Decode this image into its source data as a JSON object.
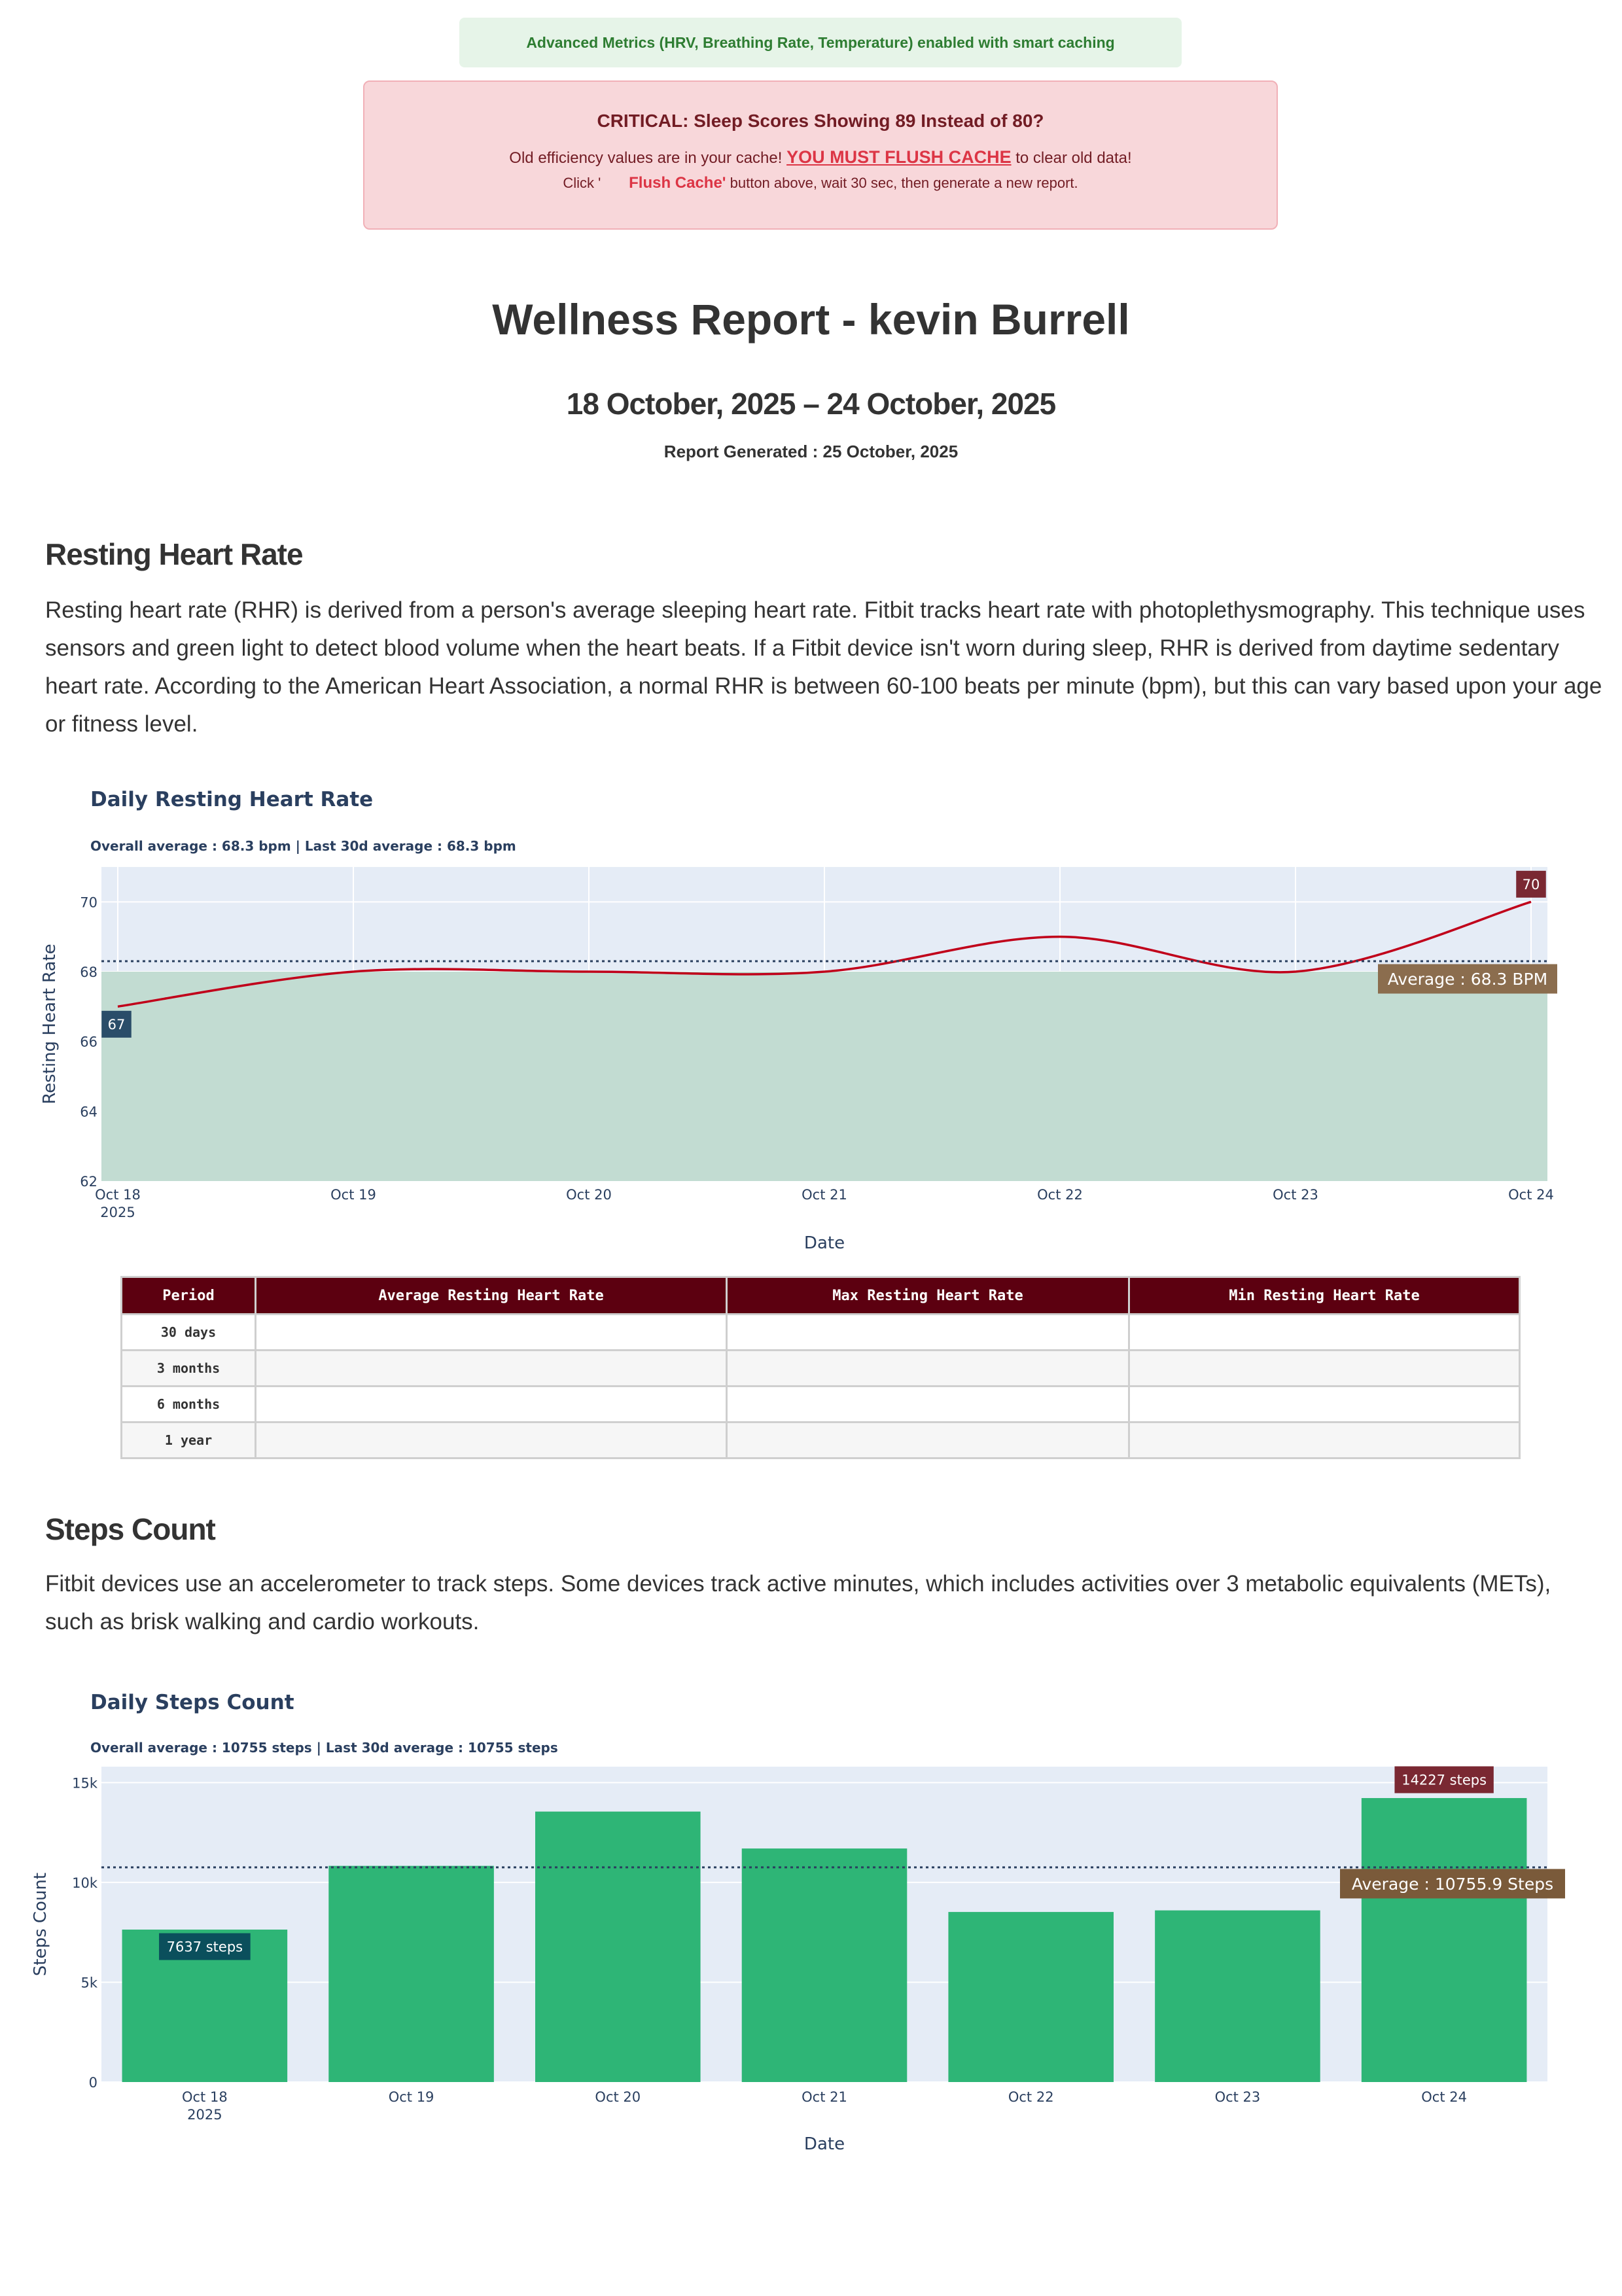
{
  "notice": "Advanced Metrics (HRV, Breathing Rate, Temperature) enabled with smart caching",
  "critical": {
    "title": "CRITICAL: Sleep Scores Showing 89 Instead of 80?",
    "line1_before": "Old efficiency values are in your cache! ",
    "line1_flush": "YOU MUST FLUSH CACHE",
    "line1_after": " to clear old data!",
    "line2_before": "Click '",
    "line2_button": "Flush Cache'",
    "line2_after": " button above, wait 30 sec, then generate a new report."
  },
  "report": {
    "title": "Wellness Report - kevin Burrell",
    "date_range": "18 October, 2025 – 24 October, 2025",
    "generated": "Report Generated : 25 October, 2025"
  },
  "rhr_section": {
    "heading": "Resting Heart Rate",
    "description": "Resting heart rate (RHR) is derived from a person's average sleeping heart rate. Fitbit tracks heart rate with photoplethysmography. This technique uses sensors and green light to detect blood volume when the heart beats. If a Fitbit device isn't worn during sleep, RHR is derived from daytime sedentary heart rate. According to the American Heart Association, a normal RHR is between 60-100 beats per minute (bpm), but this can vary based upon your age or fitness level.",
    "table": {
      "headers": [
        "Period",
        "Average Resting Heart Rate",
        "Max Resting Heart Rate",
        "Min Resting Heart Rate"
      ],
      "rows": [
        [
          "30 days",
          "",
          "",
          ""
        ],
        [
          "3 months",
          "",
          "",
          ""
        ],
        [
          "6 months",
          "",
          "",
          ""
        ],
        [
          "1 year",
          "",
          "",
          ""
        ]
      ]
    }
  },
  "steps_section": {
    "heading": "Steps Count",
    "description": "Fitbit devices use an accelerometer to track steps. Some devices track active minutes, which includes activities over 3 metabolic equivalents (METs), such as brisk walking and cardio workouts."
  },
  "chart_data": [
    {
      "type": "line",
      "title": "Daily Resting Heart Rate",
      "subtitle": "Overall average : 68.3 bpm | Last 30d average : 68.3 bpm",
      "xlabel": "Date",
      "ylabel": "Resting Heart Rate",
      "categories": [
        "Oct 18",
        "Oct 19",
        "Oct 20",
        "Oct 21",
        "Oct 22",
        "Oct 23",
        "Oct 24"
      ],
      "year_label": "2025",
      "values": [
        67,
        68,
        68,
        68,
        69,
        68,
        70
      ],
      "ylim": [
        62,
        71
      ],
      "yticks": [
        62,
        64,
        66,
        68,
        70
      ],
      "average": 68.3,
      "average_label": "Average : 68.3 BPM",
      "min_label": "67",
      "max_label": "70",
      "grid": true,
      "colors": {
        "line": "#c0001a",
        "fill": "#c2dcd2",
        "plot_bg": "#e5ecf6",
        "avg_line": "#2a3f5f",
        "avg_box": "#8b6d4e",
        "min_box": "#2a4d69",
        "max_box": "#7a2832"
      }
    },
    {
      "type": "bar",
      "title": "Daily Steps Count",
      "subtitle": "Overall average : 10755 steps | Last 30d average : 10755 steps",
      "xlabel": "Date",
      "ylabel": "Steps Count",
      "categories": [
        "Oct 18",
        "Oct 19",
        "Oct 20",
        "Oct 21",
        "Oct 22",
        "Oct 23",
        "Oct 24"
      ],
      "year_label": "2025",
      "values": [
        7637,
        10830,
        13550,
        11700,
        8520,
        8600,
        14227
      ],
      "ylim": [
        0,
        15800
      ],
      "yticks": [
        0,
        5000,
        10000,
        15000
      ],
      "ytick_labels": [
        "0",
        "5k",
        "10k",
        "15k"
      ],
      "average": 10755.9,
      "average_label": "Average : 10755.9 Steps",
      "min_label": "7637 steps",
      "max_label": "14227 steps",
      "grid": true,
      "colors": {
        "bar": "#2eb576",
        "plot_bg": "#e5ecf6",
        "avg_line": "#2a3f5f",
        "avg_box": "#7a5a3a",
        "min_box": "#0b4f5c",
        "max_box": "#7a2832"
      }
    }
  ]
}
